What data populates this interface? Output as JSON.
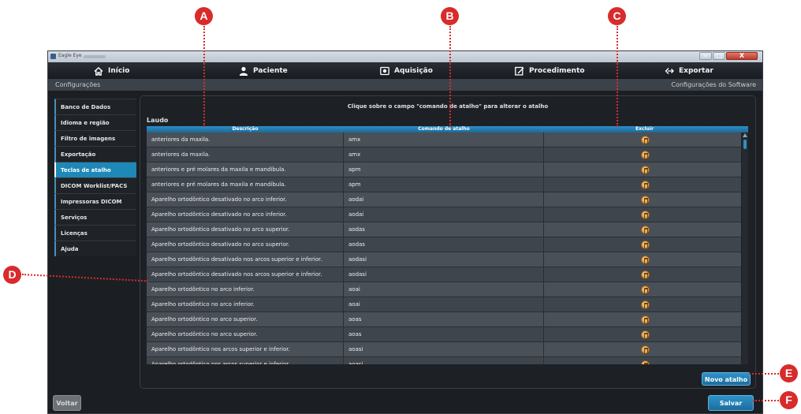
{
  "window": {
    "title": "Eagle Eye",
    "controls": {
      "minimize": "–",
      "maximize": "□",
      "close": "X"
    }
  },
  "nav": {
    "items": [
      {
        "label": "Início",
        "icon": "home-icon"
      },
      {
        "label": "Paciente",
        "icon": "user-icon"
      },
      {
        "label": "Aquisição",
        "icon": "camera-icon"
      },
      {
        "label": "Procedimento",
        "icon": "edit-icon"
      },
      {
        "label": "Exportar",
        "icon": "export-icon"
      }
    ]
  },
  "config_bar": {
    "left": "Configurações",
    "right": "Configurações do Software"
  },
  "sidebar": {
    "items": [
      {
        "label": "Banco de Dados"
      },
      {
        "label": "Idioma e região"
      },
      {
        "label": "Filtro de imagens"
      },
      {
        "label": "Exportação"
      },
      {
        "label": "Teclas de atalho",
        "active": true
      },
      {
        "label": "DICOM Worklist/PACS"
      },
      {
        "label": "Impressoras DICOM"
      },
      {
        "label": "Serviços"
      },
      {
        "label": "Licenças"
      },
      {
        "label": "Ajuda"
      }
    ]
  },
  "main": {
    "instruction": "Clique sobre o campo \"comando de atalho\" para alterar o atalho",
    "section_title": "Laudo",
    "columns": [
      "Descrição",
      "Comando de atalho",
      "Excluir"
    ],
    "rows": [
      {
        "descricao": "anteriores da maxila.",
        "comando": "amx"
      },
      {
        "descricao": "anteriores da maxila.",
        "comando": "amx"
      },
      {
        "descricao": "anteriores e pré molares da maxila e mandíbula.",
        "comando": "apm"
      },
      {
        "descricao": "anteriores e pré molares da maxila e mandíbula.",
        "comando": "apm"
      },
      {
        "descricao": "Aparelho ortodôntico desativado no arco inferior.",
        "comando": "aodai"
      },
      {
        "descricao": "Aparelho ortodôntico desativado no arco inferior.",
        "comando": "aodai"
      },
      {
        "descricao": "Aparelho ortodôntico desativado no arco superior.",
        "comando": "aodas"
      },
      {
        "descricao": "Aparelho ortodôntico desativado no arco superior.",
        "comando": "aodas"
      },
      {
        "descricao": "Aparelho ortodôntico desativado nos arcos superior e inferior.",
        "comando": "aodasi"
      },
      {
        "descricao": "Aparelho ortodôntico desativado nos arcos superior e inferior.",
        "comando": "aodasi"
      },
      {
        "descricao": "Aparelho ortodôntico no arco inferior.",
        "comando": "aoai"
      },
      {
        "descricao": "Aparelho ortodôntico no arco inferior.",
        "comando": "aoai"
      },
      {
        "descricao": "Aparelho ortodôntico no arco superior.",
        "comando": "aoas"
      },
      {
        "descricao": "Aparelho ortodôntico no arco superior.",
        "comando": "aoas"
      },
      {
        "descricao": "Aparelho ortodôntico nos arcos superior e inferior.",
        "comando": "aoasi"
      },
      {
        "descricao": "Aparelho ortodôntico nos arcos superior e inferior.",
        "comando": "aoasi"
      }
    ],
    "delete_icon": "trash-icon"
  },
  "buttons": {
    "novo_atalho": "Novo atalho",
    "salvar": "Salvar",
    "voltar": "Voltar"
  },
  "callouts": {
    "a": "A",
    "b": "B",
    "c": "C",
    "d": "D",
    "e": "E",
    "f": "F"
  },
  "colors": {
    "accent": "#1e88b8",
    "callout": "#d82b2b",
    "background": "#1b1f24"
  }
}
